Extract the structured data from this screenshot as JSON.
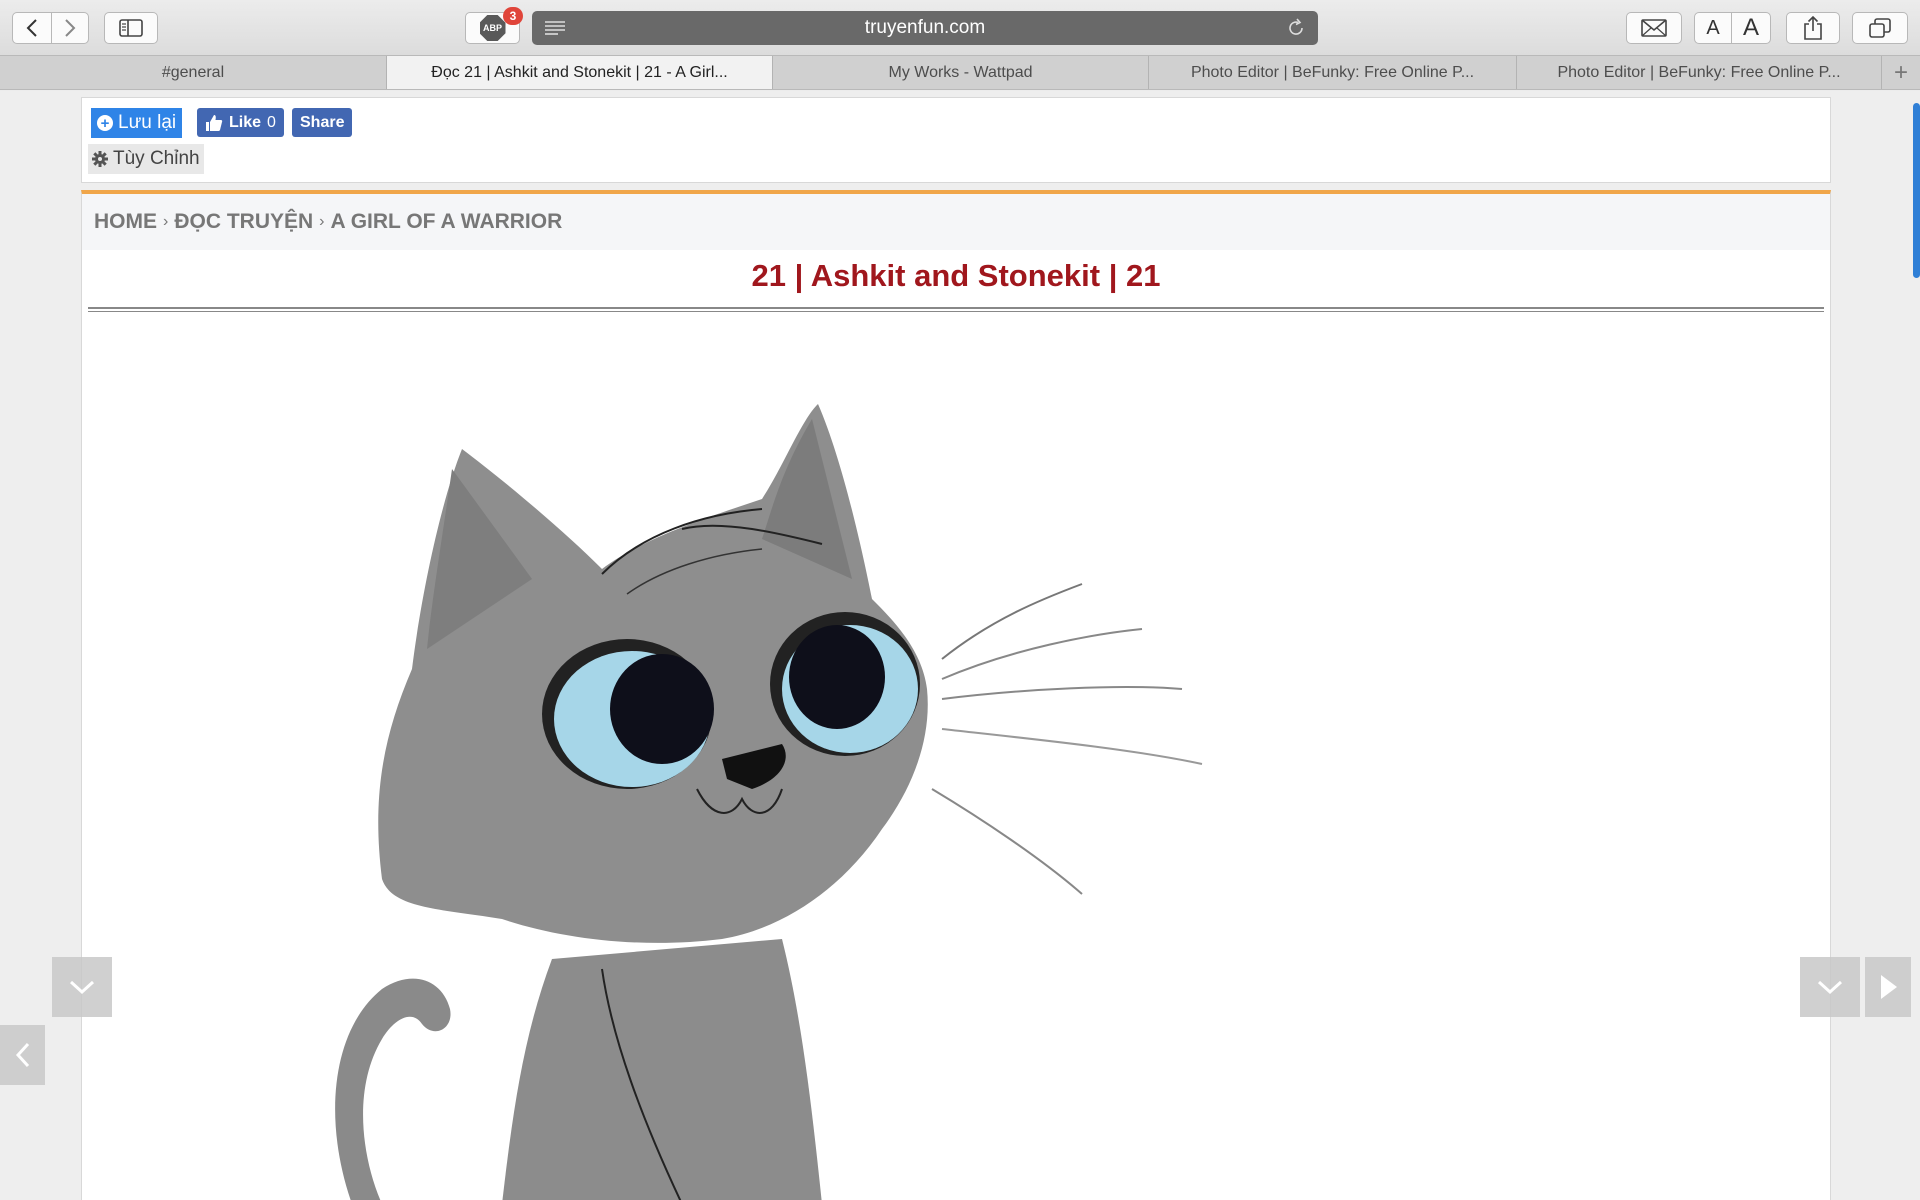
{
  "browser": {
    "url": "truyenfun.com",
    "abp_badge": "3",
    "abp_label": "ABP",
    "font_small": "A",
    "font_large": "A"
  },
  "tabs": [
    {
      "label": "#general",
      "active": false
    },
    {
      "label": "Đọc 21 | Ashkit and Stonekit | 21 - A Girl...",
      "active": true
    },
    {
      "label": "My Works - Wattpad",
      "active": false
    },
    {
      "label": "Photo Editor | BeFunky: Free Online P...",
      "active": false
    },
    {
      "label": "Photo Editor | BeFunky: Free Online P...",
      "active": false
    }
  ],
  "toolbar_box": {
    "save_label": "Lưu lại",
    "like_label": "Like",
    "like_count": "0",
    "share_label": "Share",
    "customize_label": "Tùy Chỉnh"
  },
  "breadcrumb": {
    "home": "HOME",
    "read": "ĐỌC TRUYỆN",
    "story": "A GIRL OF A WARRIOR",
    "separator": "›"
  },
  "chapter": {
    "title": "21 | Ashkit and Stonekit | 21"
  },
  "colors": {
    "accent_orange": "#f0a64a",
    "title_red": "#a0171d",
    "save_blue": "#2f84e7",
    "facebook_blue": "#4267b2"
  }
}
